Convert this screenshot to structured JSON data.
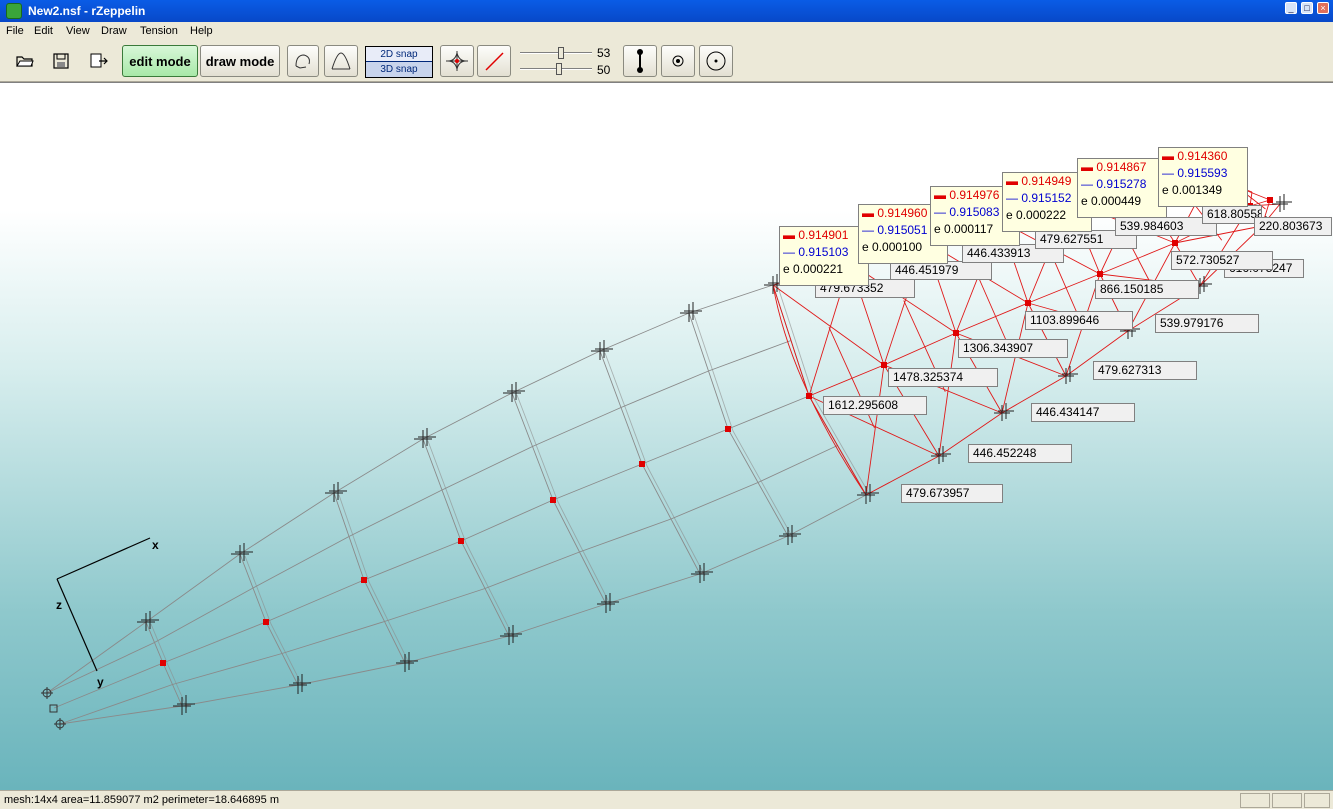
{
  "window": {
    "title": "New2.nsf - rZeppelin"
  },
  "menu": [
    "File",
    "Edit",
    "View",
    "Draw",
    "Tension",
    "Help"
  ],
  "toolbar": {
    "edit_mode": "edit mode",
    "draw_mode": "draw mode",
    "snap_2d": "2D snap",
    "snap_3d": "3D snap",
    "slider1_value": "53",
    "slider2_value": "50"
  },
  "axes": {
    "x": "x",
    "z": "z",
    "y": "y"
  },
  "tooltips": [
    {
      "red": "0.914901",
      "blue": "0.915103",
      "e": "0.000221"
    },
    {
      "red": "0.914960",
      "blue": "0.915051",
      "e": "0.000100"
    },
    {
      "red": "0.914976",
      "blue": "0.915083",
      "e": "0.000117"
    },
    {
      "red": "0.914949",
      "blue": "0.915152",
      "e": "0.000222"
    },
    {
      "red": "0.914867",
      "blue": "0.915278",
      "e": "0.000449"
    },
    {
      "red": "0.914360",
      "blue": "0.915593",
      "e": "0.001349"
    }
  ],
  "labels": [
    "479.673352",
    "446.451979",
    "446.433913",
    "479.627551",
    "539.984603",
    "618.805588",
    "220.803673",
    "572.730527",
    "616.075247",
    "866.150185",
    "1103.899646",
    "539.979176",
    "1306.343907",
    "1478.325374",
    "479.627313",
    "1612.295608",
    "446.434147",
    "446.452248",
    "479.673957"
  ],
  "status": {
    "text": "mesh:14x4  area=11.859077 m2  perimeter=18.646895 m"
  }
}
